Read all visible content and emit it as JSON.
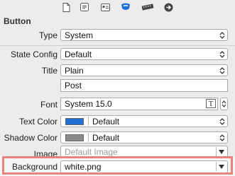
{
  "toolbar": {
    "icons": [
      "file-icon",
      "quick-help-icon",
      "identity-icon",
      "attributes-icon",
      "size-ruler-icon",
      "connections-arrow-icon"
    ],
    "selected_index": 3,
    "accent": "#1f6fd6"
  },
  "section": {
    "title": "Button"
  },
  "rows": {
    "type": {
      "label": "Type",
      "value": "System"
    },
    "state_config": {
      "label": "State Config",
      "value": "Default"
    },
    "title": {
      "label": "Title",
      "value": "Plain"
    },
    "title_text": {
      "value": "Post"
    },
    "font": {
      "label": "Font",
      "value": "System 15.0"
    },
    "text_color": {
      "label": "Text Color",
      "value": "Default",
      "swatch": "#1f6fd6"
    },
    "shadow_color": {
      "label": "Shadow Color",
      "value": "Default",
      "swatch": "#8a8a8a"
    },
    "image": {
      "label": "Image",
      "placeholder": "Default Image"
    },
    "background": {
      "label": "Background",
      "value": "white.png"
    }
  },
  "highlight_color": "#e9827d"
}
